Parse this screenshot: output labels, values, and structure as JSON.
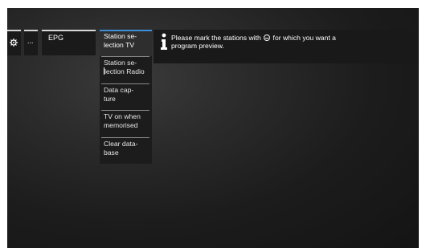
{
  "menu": {
    "settings_icon": "gear-icon",
    "more_label": "...",
    "epg_label": "EPG"
  },
  "submenu": {
    "items": [
      {
        "line1": "Station se-",
        "line2": "lection TV"
      },
      {
        "line1": "Station se-",
        "line2": "lection Radio"
      },
      {
        "line1": "Data cap-",
        "line2": "ture"
      },
      {
        "line1": "TV on when",
        "line2": "memorised"
      },
      {
        "line1": "Clear data-",
        "line2": "base"
      }
    ]
  },
  "info": {
    "icon": "info-icon",
    "text_before_icon": "Please mark the stations with",
    "inline_icon": "circle-minus-icon",
    "text_after_icon": " for which you want a",
    "text_line2": "program preview."
  },
  "colors": {
    "accent": "#3e8fd8",
    "background": "#1c1c1c"
  }
}
